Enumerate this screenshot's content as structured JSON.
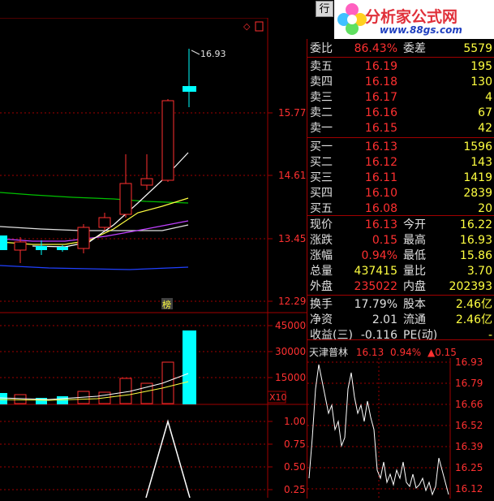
{
  "toolbar": {
    "button_label": "行"
  },
  "logo": {
    "title": "分析家公式网",
    "url": "www.88gs.com"
  },
  "chart": {
    "high_marker": "16.93",
    "price_ticks": [
      "15.77",
      "14.61",
      "13.45",
      "12.29"
    ],
    "volume_ticks": [
      "45000",
      "30000",
      "15000"
    ],
    "volume_multiplier": "X10",
    "indicator_ticks": [
      "1.00",
      "0.75",
      "0.50",
      "0.25"
    ],
    "board_tag": "榜",
    "header_stock": "天津普林"
  },
  "quote": {
    "weibi": {
      "label": "委比",
      "value": "86.43%",
      "label2": "委差",
      "value2": "5579"
    },
    "asks": [
      {
        "label": "卖五",
        "price": "16.19",
        "vol": "195"
      },
      {
        "label": "卖四",
        "price": "16.18",
        "vol": "130"
      },
      {
        "label": "卖三",
        "price": "16.17",
        "vol": "4"
      },
      {
        "label": "卖二",
        "price": "16.16",
        "vol": "67"
      },
      {
        "label": "卖一",
        "price": "16.15",
        "vol": "42"
      }
    ],
    "bids": [
      {
        "label": "买一",
        "price": "16.13",
        "vol": "1596"
      },
      {
        "label": "买二",
        "price": "16.12",
        "vol": "143"
      },
      {
        "label": "买三",
        "price": "16.11",
        "vol": "1419"
      },
      {
        "label": "买四",
        "price": "16.10",
        "vol": "2839"
      },
      {
        "label": "买五",
        "price": "16.08",
        "vol": "20"
      }
    ],
    "stats1": [
      {
        "l1": "现价",
        "v1": "16.13",
        "c1": "red",
        "l2": "今开",
        "v2": "16.22",
        "c2": "red"
      },
      {
        "l1": "涨跌",
        "v1": "0.15",
        "c1": "red",
        "l2": "最高",
        "v2": "16.93",
        "c2": "red"
      },
      {
        "l1": "涨幅",
        "v1": "0.94%",
        "c1": "red",
        "l2": "最低",
        "v2": "15.86",
        "c2": "green"
      },
      {
        "l1": "总量",
        "v1": "437415",
        "c1": "yellow",
        "l2": "量比",
        "v2": "3.70",
        "c2": "purple"
      },
      {
        "l1": "外盘",
        "v1": "235022",
        "c1": "red",
        "l2": "内盘",
        "v2": "202393",
        "c2": "green"
      }
    ],
    "stats2": [
      {
        "l1": "换手",
        "v1": "17.79%",
        "l2": "股本",
        "v2": "2.46亿"
      },
      {
        "l1": "净资",
        "v1": "2.01",
        "l2": "流通",
        "v2": "2.46亿"
      },
      {
        "l1": "收益(三)",
        "v1": "-0.116",
        "l2": "PE(动)",
        "v2": "-"
      }
    ]
  },
  "minichart": {
    "name": "天津普林",
    "price": "16.13",
    "pct": "0.94%",
    "change": "▲0.15",
    "ticks": [
      "16.93",
      "16.79",
      "16.66",
      "16.52",
      "16.39",
      "16.25",
      "16.12"
    ]
  },
  "colors": {
    "up": "#ff3030",
    "down": "#00ffff",
    "grid": "#a00000",
    "ma_white": "#ffffff",
    "ma_yellow": "#ffff40",
    "ma_purple": "#c040ff",
    "ma_green": "#00c000",
    "ma_blue": "#2040ff"
  }
}
